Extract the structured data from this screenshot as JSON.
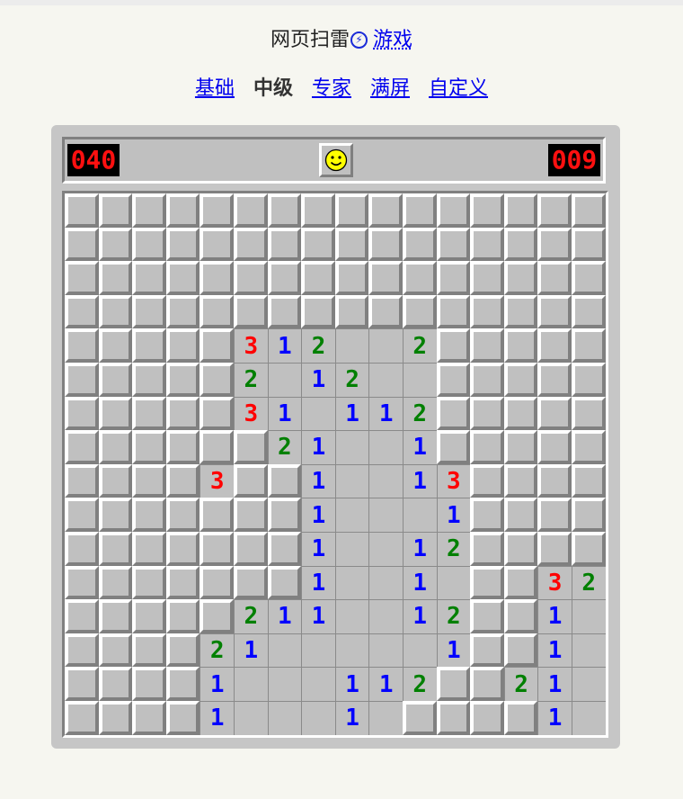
{
  "page": {
    "title": "网页扫雷",
    "title_link": "游戏"
  },
  "levels": [
    {
      "label": "基础",
      "current": false
    },
    {
      "label": "中级",
      "current": true
    },
    {
      "label": "专家",
      "current": false
    },
    {
      "label": "满屏",
      "current": false
    },
    {
      "label": "自定义",
      "current": false
    }
  ],
  "game": {
    "mines_left": "040",
    "timer": "009",
    "face": "smile",
    "colors": {
      "n1": "#0000ff",
      "n2": "#008000",
      "n3": "#ff0000"
    },
    "rows": [
      "################",
      "################",
      "################",
      "################",
      "#####312  2#####",
      "#####2 12  #####",
      "#####31 112#####",
      "######21  1#####",
      "####3##1  13####",
      "#######1   1####",
      "#######1  12####",
      "#######1  1 ##32",
      "#####211  12##1 ",
      "####21     1##1 ",
      "####1   112##21 ",
      "####1   1 ####1 "
    ]
  }
}
